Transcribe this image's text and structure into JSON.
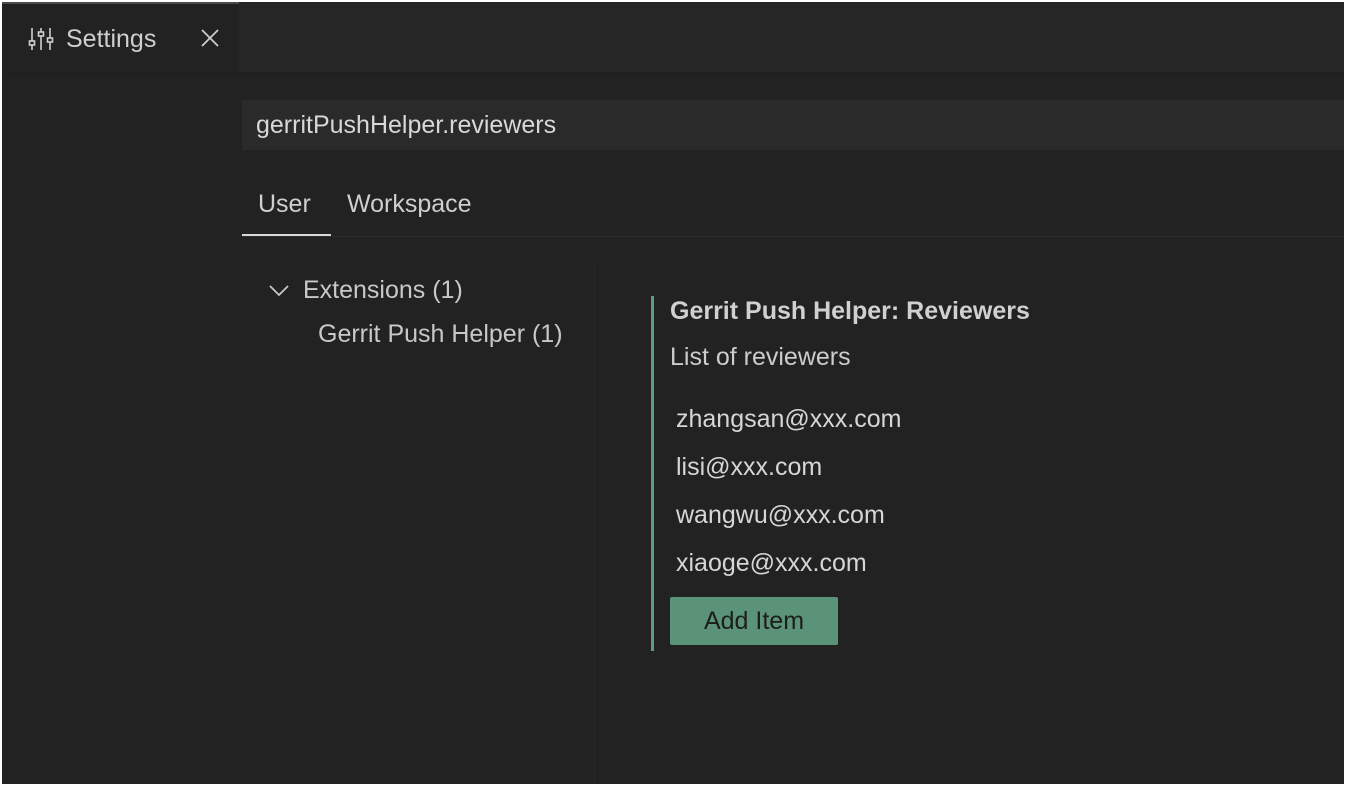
{
  "tab": {
    "icon": "settings-sliders-icon",
    "label": "Settings",
    "close_icon": "close-icon"
  },
  "search": {
    "value": "gerritPushHelper.reviewers"
  },
  "scope_tabs": {
    "user": "User",
    "workspace": "Workspace",
    "active": "User"
  },
  "toc": {
    "extensions_label": "Extensions (1)",
    "chevron_icon": "chevron-down-icon",
    "sub_item_label": "Gerrit Push Helper (1)"
  },
  "setting": {
    "title": "Gerrit Push Helper: Reviewers",
    "description": "List of reviewers",
    "items": [
      "zhangsan@xxx.com",
      "lisi@xxx.com",
      "wangwu@xxx.com",
      "xiaoge@xxx.com"
    ],
    "add_button_label": "Add Item"
  },
  "colors": {
    "background": "#222222",
    "accent": "#5e9c7e",
    "button": "#5a9377",
    "text": "#cfcfcf"
  }
}
